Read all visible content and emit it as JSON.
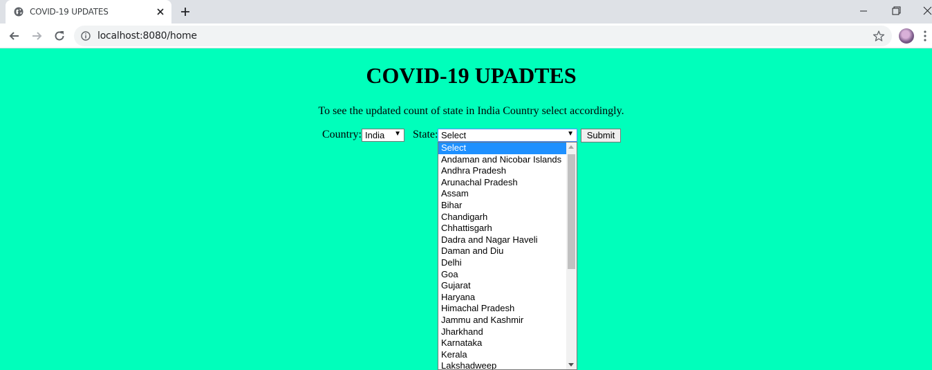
{
  "browser": {
    "tab_title": "COVID-19 UPDATES",
    "url": "localhost:8080/home"
  },
  "page": {
    "title": "COVID-19 UPADTES",
    "intro": "To see the updated count of state in India Country select accordingly.",
    "country_label": "Country:",
    "country_value": "India",
    "state_label": "State:",
    "state_value": "Select",
    "submit_label": "Submit"
  },
  "state_options": [
    "Select",
    "Andaman and Nicobar Islands",
    "Andhra Pradesh",
    "Arunachal Pradesh",
    "Assam",
    "Bihar",
    "Chandigarh",
    "Chhattisgarh",
    "Dadra and Nagar Haveli",
    "Daman and Diu",
    "Delhi",
    "Goa",
    "Gujarat",
    "Haryana",
    "Himachal Pradesh",
    "Jammu and Kashmir",
    "Jharkhand",
    "Karnataka",
    "Kerala",
    "Lakshadweep"
  ],
  "highlighted_option": "Select",
  "colors": {
    "page_background": "#00ffbb",
    "highlight": "#1e90ff"
  }
}
